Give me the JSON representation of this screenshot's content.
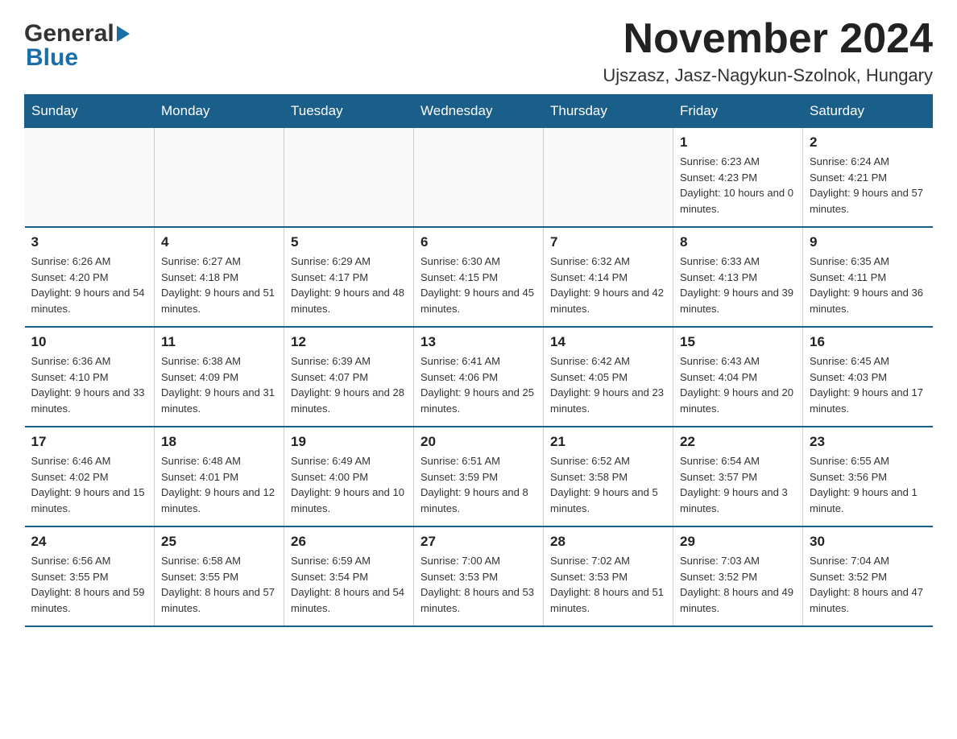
{
  "logo": {
    "line1": "General",
    "line2": "Blue"
  },
  "header": {
    "month": "November 2024",
    "location": "Ujszasz, Jasz-Nagykun-Szolnok, Hungary"
  },
  "weekdays": [
    "Sunday",
    "Monday",
    "Tuesday",
    "Wednesday",
    "Thursday",
    "Friday",
    "Saturday"
  ],
  "weeks": [
    [
      {
        "day": "",
        "info": ""
      },
      {
        "day": "",
        "info": ""
      },
      {
        "day": "",
        "info": ""
      },
      {
        "day": "",
        "info": ""
      },
      {
        "day": "",
        "info": ""
      },
      {
        "day": "1",
        "info": "Sunrise: 6:23 AM\nSunset: 4:23 PM\nDaylight: 10 hours and 0 minutes."
      },
      {
        "day": "2",
        "info": "Sunrise: 6:24 AM\nSunset: 4:21 PM\nDaylight: 9 hours and 57 minutes."
      }
    ],
    [
      {
        "day": "3",
        "info": "Sunrise: 6:26 AM\nSunset: 4:20 PM\nDaylight: 9 hours and 54 minutes."
      },
      {
        "day": "4",
        "info": "Sunrise: 6:27 AM\nSunset: 4:18 PM\nDaylight: 9 hours and 51 minutes."
      },
      {
        "day": "5",
        "info": "Sunrise: 6:29 AM\nSunset: 4:17 PM\nDaylight: 9 hours and 48 minutes."
      },
      {
        "day": "6",
        "info": "Sunrise: 6:30 AM\nSunset: 4:15 PM\nDaylight: 9 hours and 45 minutes."
      },
      {
        "day": "7",
        "info": "Sunrise: 6:32 AM\nSunset: 4:14 PM\nDaylight: 9 hours and 42 minutes."
      },
      {
        "day": "8",
        "info": "Sunrise: 6:33 AM\nSunset: 4:13 PM\nDaylight: 9 hours and 39 minutes."
      },
      {
        "day": "9",
        "info": "Sunrise: 6:35 AM\nSunset: 4:11 PM\nDaylight: 9 hours and 36 minutes."
      }
    ],
    [
      {
        "day": "10",
        "info": "Sunrise: 6:36 AM\nSunset: 4:10 PM\nDaylight: 9 hours and 33 minutes."
      },
      {
        "day": "11",
        "info": "Sunrise: 6:38 AM\nSunset: 4:09 PM\nDaylight: 9 hours and 31 minutes."
      },
      {
        "day": "12",
        "info": "Sunrise: 6:39 AM\nSunset: 4:07 PM\nDaylight: 9 hours and 28 minutes."
      },
      {
        "day": "13",
        "info": "Sunrise: 6:41 AM\nSunset: 4:06 PM\nDaylight: 9 hours and 25 minutes."
      },
      {
        "day": "14",
        "info": "Sunrise: 6:42 AM\nSunset: 4:05 PM\nDaylight: 9 hours and 23 minutes."
      },
      {
        "day": "15",
        "info": "Sunrise: 6:43 AM\nSunset: 4:04 PM\nDaylight: 9 hours and 20 minutes."
      },
      {
        "day": "16",
        "info": "Sunrise: 6:45 AM\nSunset: 4:03 PM\nDaylight: 9 hours and 17 minutes."
      }
    ],
    [
      {
        "day": "17",
        "info": "Sunrise: 6:46 AM\nSunset: 4:02 PM\nDaylight: 9 hours and 15 minutes."
      },
      {
        "day": "18",
        "info": "Sunrise: 6:48 AM\nSunset: 4:01 PM\nDaylight: 9 hours and 12 minutes."
      },
      {
        "day": "19",
        "info": "Sunrise: 6:49 AM\nSunset: 4:00 PM\nDaylight: 9 hours and 10 minutes."
      },
      {
        "day": "20",
        "info": "Sunrise: 6:51 AM\nSunset: 3:59 PM\nDaylight: 9 hours and 8 minutes."
      },
      {
        "day": "21",
        "info": "Sunrise: 6:52 AM\nSunset: 3:58 PM\nDaylight: 9 hours and 5 minutes."
      },
      {
        "day": "22",
        "info": "Sunrise: 6:54 AM\nSunset: 3:57 PM\nDaylight: 9 hours and 3 minutes."
      },
      {
        "day": "23",
        "info": "Sunrise: 6:55 AM\nSunset: 3:56 PM\nDaylight: 9 hours and 1 minute."
      }
    ],
    [
      {
        "day": "24",
        "info": "Sunrise: 6:56 AM\nSunset: 3:55 PM\nDaylight: 8 hours and 59 minutes."
      },
      {
        "day": "25",
        "info": "Sunrise: 6:58 AM\nSunset: 3:55 PM\nDaylight: 8 hours and 57 minutes."
      },
      {
        "day": "26",
        "info": "Sunrise: 6:59 AM\nSunset: 3:54 PM\nDaylight: 8 hours and 54 minutes."
      },
      {
        "day": "27",
        "info": "Sunrise: 7:00 AM\nSunset: 3:53 PM\nDaylight: 8 hours and 53 minutes."
      },
      {
        "day": "28",
        "info": "Sunrise: 7:02 AM\nSunset: 3:53 PM\nDaylight: 8 hours and 51 minutes."
      },
      {
        "day": "29",
        "info": "Sunrise: 7:03 AM\nSunset: 3:52 PM\nDaylight: 8 hours and 49 minutes."
      },
      {
        "day": "30",
        "info": "Sunrise: 7:04 AM\nSunset: 3:52 PM\nDaylight: 8 hours and 47 minutes."
      }
    ]
  ]
}
